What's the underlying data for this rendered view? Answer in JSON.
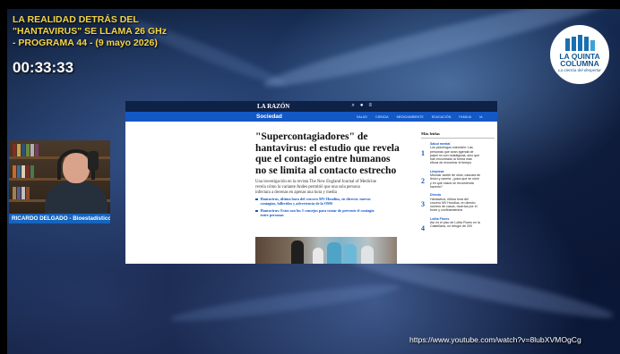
{
  "overlay": {
    "title_lines": [
      "LA REALIDAD DETRÁS DEL",
      "\"HANTAVIRUS\" SE LLAMA 26 GHz",
      "- PROGRAMA 44 - (9 mayo 2026)"
    ],
    "timer": "00:33:33",
    "speaker": "RICARDO DELGADO - Bioestadístico",
    "url": "https://www.youtube.com/watch?v=8lubXVMOgCg"
  },
  "logo": {
    "name_lines": [
      "LA QUINTA",
      "COLUMNA"
    ],
    "tagline": "La ciencia del despertar"
  },
  "browser": {
    "brand": "LA RAZÓN",
    "section": "Sociedad",
    "nav_links": [
      "SALUD",
      "CIENCIA",
      "MEDIOAMBIENTE",
      "EDUCACIÓN",
      "FAMILIA",
      "IA"
    ],
    "icons": [
      "search-icon",
      "user-icon",
      "menu-icon"
    ],
    "headline_lines": [
      "\"Supercontagiadores\" de",
      "hantavirus: el estudio que revela",
      "que el contagio entre humanos",
      "no se limita al contacto estrecho"
    ],
    "lede_lines": [
      "Una investigación en la revista The New England Journal of Medicine",
      "revela cómo la variante Andes permitió que una sola persona",
      "infectara a decenas en apenas una hora y media"
    ],
    "bullets": [
      [
        "Hantavirus, última hora del crucero MV Hondius, en directo: nuevos",
        "contagios, fallecidos y advertencia de la OMS"
      ],
      [
        "Hantavirus: Estos son los 5 consejos para tratar de prevenir el contagio",
        "entre personas"
      ]
    ],
    "sidebar": {
      "title": "Más leídas",
      "items": [
        {
          "num": "1",
          "category": "Salud mental",
          "lines": [
            "Los psicólogos coinciden: Las",
            "personas que sean agenda de",
            "papel no son nostálgicas, sino que",
            "han encontrado la forma más",
            "eficaz de encontrar el tiempo"
          ]
        },
        {
          "num": "2",
          "category": "Limpieza",
          "lines": [
            "Mezclar aceite de oliva, cáscara de",
            "limón y canela: ¿para qué se sirve",
            "y en qué casos se recomienda",
            "hacerlo?"
          ]
        },
        {
          "num": "3",
          "category": "Directo",
          "lines": [
            "Hantavirus, última hora del",
            "crucero MV Hondius, en directo:",
            "número de casos, muertos por el",
            "brote y confinamientos"
          ]
        },
        {
          "num": "4",
          "category": "Lolita Flores",
          "lines": [
            "Así es el piso de Lolita Flores en la",
            "Castellana, un refugio de 200"
          ]
        }
      ]
    }
  }
}
